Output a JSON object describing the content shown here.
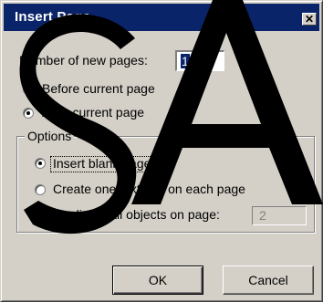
{
  "dialog": {
    "title": "Insert Page",
    "close_symbol": "✕"
  },
  "number_field": {
    "label": "Number of new pages:",
    "value": "1"
  },
  "placement": {
    "before_label": "Before current page",
    "after_label": "After current page",
    "selected": "after"
  },
  "options": {
    "legend": "Options",
    "insert_blank_label": "Insert blank pages",
    "text_box_label": "Create one text box on each page",
    "duplicate_label": "Duplicate all objects on page:",
    "duplicate_value": "2",
    "selected": "insert_blank"
  },
  "buttons": {
    "ok_label": "OK",
    "cancel_label": "Cancel"
  },
  "watermark": {
    "text": "SA",
    "color": "#000000"
  },
  "colors": {
    "titlebar": "#0a246a",
    "face": "#d4d0c8"
  }
}
